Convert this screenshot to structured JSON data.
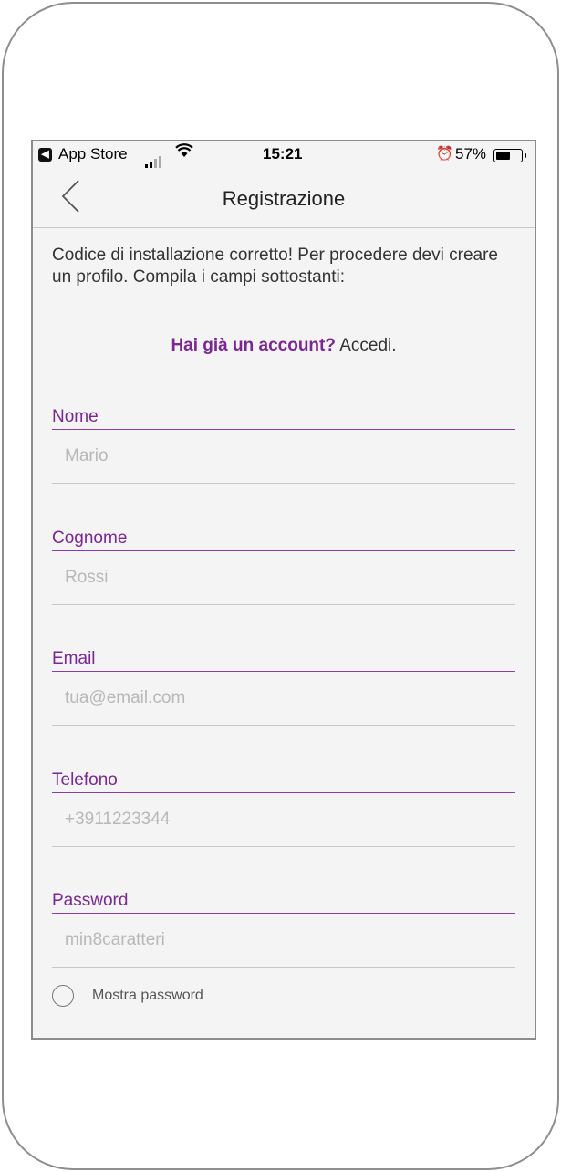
{
  "status_bar": {
    "back_app": "App Store",
    "back_glyph": "◀",
    "signal_icon": "cellular-signal-icon",
    "wifi_icon": "wifi-icon",
    "time": "15:21",
    "alarm_icon": "alarm-clock-icon",
    "battery_percent": "57%",
    "battery_level": 0.57
  },
  "nav": {
    "title": "Registrazione",
    "back_icon": "chevron-left-icon"
  },
  "intro_text": "Codice di installazione corretto!  Per procedere devi creare un profilo. Compila i campi sottostanti:",
  "account_prompt": {
    "question": "Hai già un account?",
    "action": "Accedi."
  },
  "fields": [
    {
      "label": "Nome",
      "placeholder": "Mario",
      "value": ""
    },
    {
      "label": "Cognome",
      "placeholder": "Rossi",
      "value": ""
    },
    {
      "label": "Email",
      "placeholder": "tua@email.com",
      "value": ""
    },
    {
      "label": "Telefono",
      "placeholder": "+3911223344",
      "value": ""
    },
    {
      "label": "Password",
      "placeholder": "min8caratteri",
      "value": ""
    }
  ],
  "show_password": {
    "label": "Mostra password",
    "checked": false
  },
  "colors": {
    "accent": "#7a2694",
    "background": "#f4f4f4",
    "placeholder": "#b8b8b8"
  }
}
